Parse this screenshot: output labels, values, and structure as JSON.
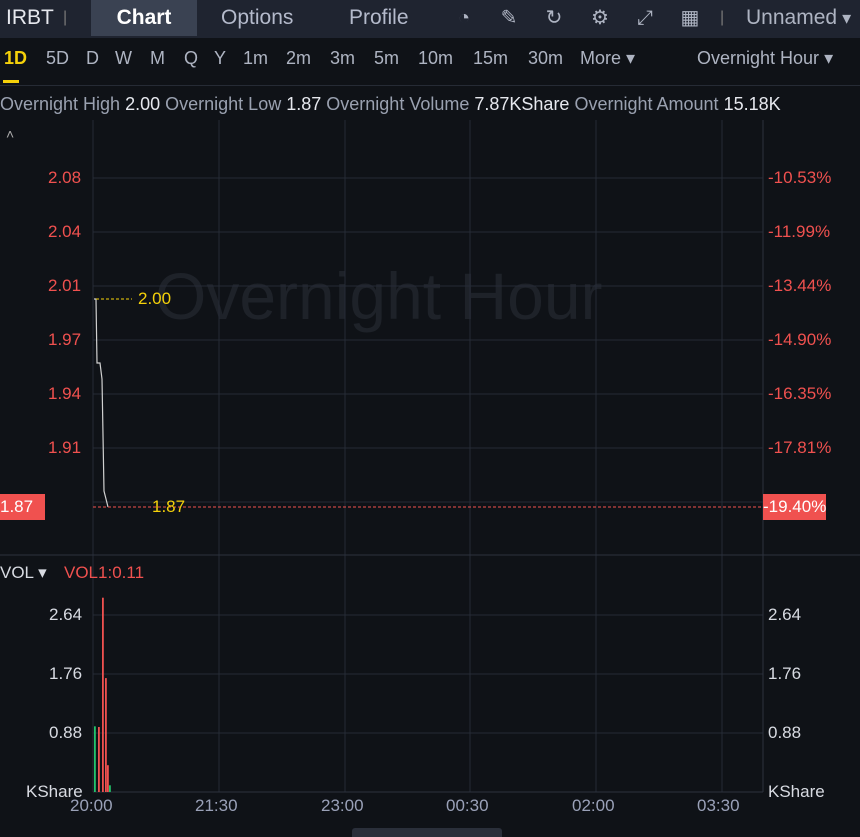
{
  "header": {
    "symbol": "IRBT",
    "tabs": [
      "Chart",
      "Options",
      "Profile"
    ],
    "active_tab": "Chart",
    "icons": [
      "indicator-icon",
      "draw-icon",
      "refresh-icon",
      "settings-icon",
      "fullscreen-icon",
      "layout-icon"
    ],
    "layout_name": "Unnamed"
  },
  "timeframes": {
    "items": [
      "1D",
      "5D",
      "D",
      "W",
      "M",
      "Q",
      "Y",
      "1m",
      "2m",
      "3m",
      "5m",
      "10m",
      "15m",
      "30m",
      "More"
    ],
    "active": "1D",
    "session": "Overnight Hour"
  },
  "stats": {
    "high_label": "Overnight High",
    "high": "2.00",
    "low_label": "Overnight Low",
    "low": "1.87",
    "volume_label": "Overnight Volume",
    "volume": "7.87KShare",
    "amount_label": "Overnight Amount",
    "amount": "15.18K"
  },
  "price_chart": {
    "watermark": "Overnight Hour",
    "left_ticks": [
      "2.08",
      "2.04",
      "2.01",
      "1.97",
      "1.94",
      "1.91"
    ],
    "right_ticks": [
      "-10.53%",
      "-11.99%",
      "-13.44%",
      "-14.90%",
      "-16.35%",
      "-17.81%"
    ],
    "current_price": "1.87",
    "current_pct": "-19.40%",
    "high_marker": "2.00",
    "low_marker": "1.87",
    "current_color": "#f0514f"
  },
  "volume_chart": {
    "indicator": "VOL",
    "value_label": "VOL1:0.11",
    "ticks": [
      "2.64",
      "1.76",
      "0.88"
    ],
    "unit": "KShare"
  },
  "x_axis": [
    "20:00",
    "21:30",
    "23:00",
    "00:30",
    "02:00",
    "03:30"
  ],
  "chart_data": {
    "type": "line",
    "price": [
      2.0,
      2.0,
      1.96,
      1.96,
      1.95,
      1.88,
      1.875,
      1.87
    ],
    "volume": [
      {
        "v": 0.98,
        "dir": "up"
      },
      {
        "v": 0.97,
        "dir": "down"
      },
      {
        "v": 2.9,
        "dir": "down"
      },
      {
        "v": 1.7,
        "dir": "down"
      },
      {
        "v": 0.4,
        "dir": "down"
      },
      {
        "v": 0.1,
        "dir": "up"
      }
    ]
  }
}
